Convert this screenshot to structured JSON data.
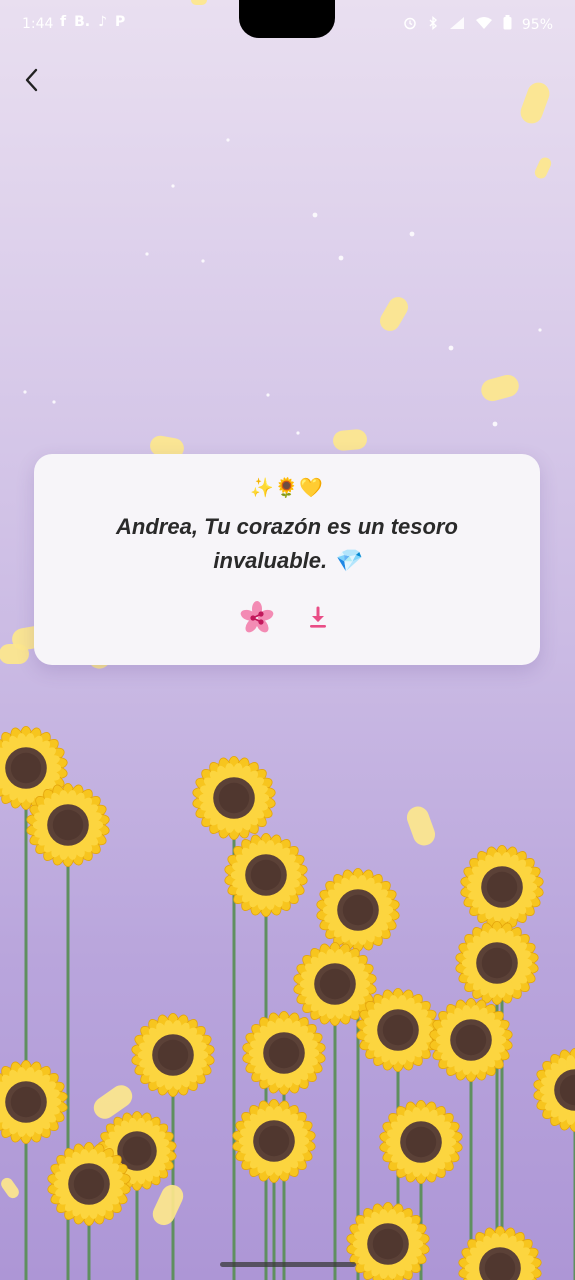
{
  "status_bar": {
    "time": "1:44",
    "app_icons": [
      "facebook-icon",
      "b-icon",
      "tiktok-icon",
      "p-icon"
    ],
    "app_icon_glyphs": [
      "f",
      "B.",
      "♪",
      "P"
    ],
    "right_icons": [
      "alarm-icon",
      "bluetooth-icon",
      "signal-icon",
      "wifi-icon",
      "battery-icon"
    ],
    "battery": "95%"
  },
  "navigation": {
    "back_icon": "chevron-left-icon"
  },
  "card": {
    "emoji_line": "✨🌻💛",
    "message": "Andrea, Tu corazón es un tesoro invaluable. 💎",
    "share_icon": "share-flower-icon",
    "download_icon": "download-icon"
  },
  "colors": {
    "background_top": "#e9dff0",
    "background_bottom": "#ad96d6",
    "card_bg": "#f7f5f9",
    "message_text": "#2a2a2a",
    "accent_pink": "#e94d86",
    "petal_yellow": "#fde78c",
    "sunflower_petal": "#f7c51e",
    "sunflower_center": "#5b4137",
    "stem_green": "#5f8f5f"
  }
}
